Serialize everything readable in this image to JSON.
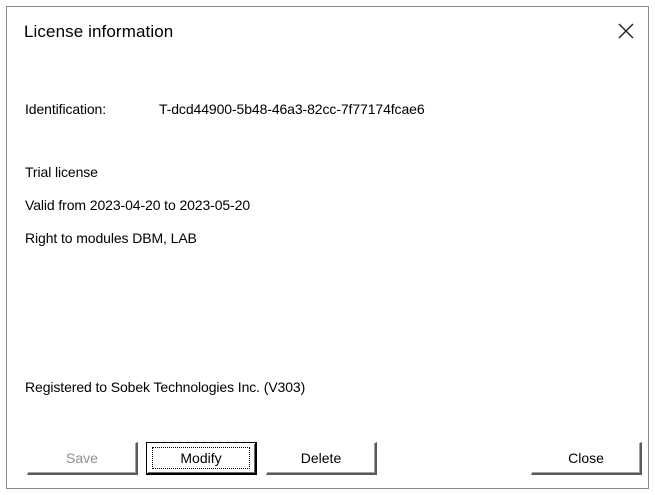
{
  "window": {
    "title": "License information"
  },
  "license": {
    "identification_label": "Identification:",
    "identification_value": "T-dcd44900-5b48-46a3-82cc-7f77174fcae6",
    "type": "Trial license",
    "validity": "Valid from 2023-04-20 to 2023-05-20",
    "modules": "Right to modules DBM, LAB",
    "registered": "Registered to Sobek Technologies Inc. (V303)"
  },
  "buttons": {
    "save": "Save",
    "modify": "Modify",
    "delete": "Delete",
    "close": "Close"
  },
  "icons": {
    "close": "close-icon"
  }
}
